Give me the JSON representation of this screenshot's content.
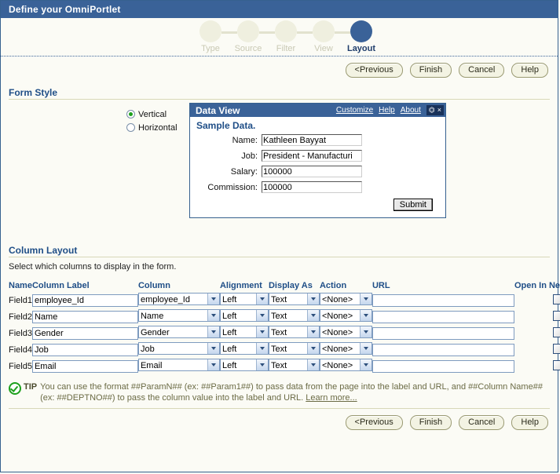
{
  "window": {
    "title": "Define your OmniPortlet"
  },
  "wizard": {
    "steps": [
      {
        "label": "Type",
        "active": false
      },
      {
        "label": "Source",
        "active": false
      },
      {
        "label": "Filter",
        "active": false
      },
      {
        "label": "View",
        "active": false
      },
      {
        "label": "Layout",
        "active": true
      }
    ]
  },
  "buttons": {
    "previous": "<Previous",
    "finish": "Finish",
    "cancel": "Cancel",
    "help": "Help"
  },
  "form_style": {
    "title": "Form Style",
    "options": [
      {
        "label": "Vertical",
        "selected": true
      },
      {
        "label": "Horizontal",
        "selected": false
      }
    ]
  },
  "portlet": {
    "title": "Data View",
    "links": {
      "customize": "Customize",
      "help": "Help",
      "about": "About"
    },
    "icons": {
      "minimize": "minimize-icon",
      "close": "close-icon"
    },
    "sample_label": "Sample Data.",
    "fields": [
      {
        "label": "Name:",
        "value": "Kathleen Bayyat"
      },
      {
        "label": "Job:",
        "value": "President - Manufacturi"
      },
      {
        "label": "Salary:",
        "value": "100000"
      },
      {
        "label": "Commission:",
        "value": "100000"
      }
    ],
    "submit": "Submit"
  },
  "column_layout": {
    "title": "Column Layout",
    "subtitle": "Select which columns to display in the form.",
    "headers": {
      "name": "Name",
      "column_label": "Column Label",
      "column": "Column",
      "alignment": "Alignment",
      "display_as": "Display As",
      "action": "Action",
      "url": "URL",
      "open_in_new_window": "Open In New Window"
    },
    "rows": [
      {
        "name": "Field1",
        "label": "employee_Id",
        "column": "employee_Id",
        "alignment": "Left",
        "display_as": "Text",
        "action": "<None>",
        "url": "",
        "open_new": false
      },
      {
        "name": "Field2",
        "label": "Name",
        "column": "Name",
        "alignment": "Left",
        "display_as": "Text",
        "action": "<None>",
        "url": "",
        "open_new": false
      },
      {
        "name": "Field3",
        "label": "Gender",
        "column": "Gender",
        "alignment": "Left",
        "display_as": "Text",
        "action": "<None>",
        "url": "",
        "open_new": false
      },
      {
        "name": "Field4",
        "label": "Job",
        "column": "Job",
        "alignment": "Left",
        "display_as": "Text",
        "action": "<None>",
        "url": "",
        "open_new": false
      },
      {
        "name": "Field5",
        "label": "Email",
        "column": "Email",
        "alignment": "Left",
        "display_as": "Text",
        "action": "<None>",
        "url": "",
        "open_new": false
      }
    ]
  },
  "tip": {
    "word": "TIP",
    "text": "You can use the format ##ParamN## (ex: ##Param1##) to pass data from the page into the label and URL, and ##Column Name## (ex: ##DEPTNO##) to pass the column value into the label and URL.",
    "link": "Learn more..."
  },
  "colors": {
    "header_blue": "#3A6298",
    "section_title": "#1F4E87",
    "page_bg": "#FBFBF5",
    "accent_rule": "#D8D8B8",
    "radio_dot_green": "#1DA01D"
  }
}
